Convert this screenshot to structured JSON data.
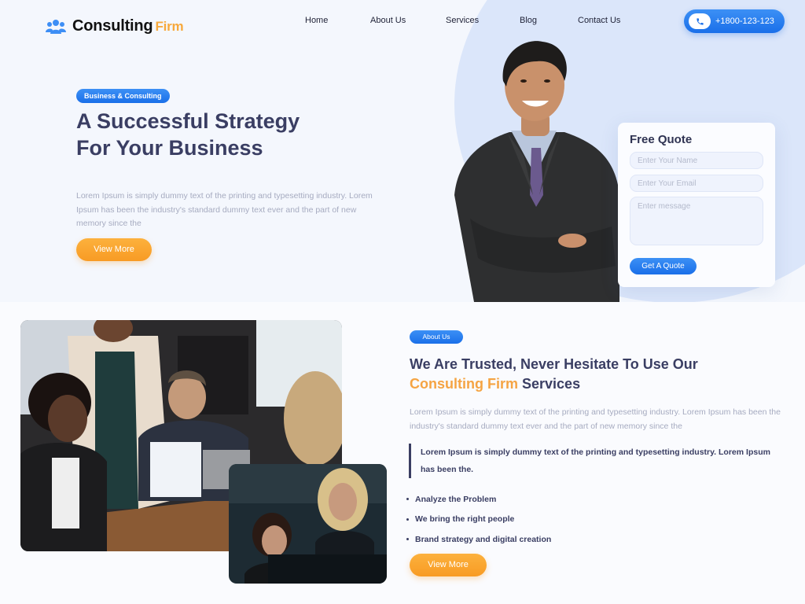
{
  "header": {
    "logo_main": "Consulting",
    "logo_accent": "Firm",
    "nav": [
      {
        "label": "Home"
      },
      {
        "label": "About Us"
      },
      {
        "label": "Services"
      },
      {
        "label": "Blog"
      },
      {
        "label": "Contact Us"
      }
    ],
    "phone": "+1800-123-123"
  },
  "hero": {
    "badge": "Business & Consulting",
    "title": "A Successful Strategy For Your Business",
    "description": "Lorem Ipsum is simply dummy text of the printing and typesetting industry. Lorem Ipsum has been the industry's standard dummy text ever and the part of new memory since the",
    "cta": "View More"
  },
  "quote_form": {
    "title": "Free Quote",
    "name_placeholder": "Enter Your Name",
    "email_placeholder": "Enter Your Email",
    "message_placeholder": "Enter message",
    "submit": "Get A Quote"
  },
  "about": {
    "badge": "About Us",
    "title_start": "We Are Trusted, Never Hesitate To Use Our",
    "title_accent": "Consulting Firm",
    "title_end": "Services",
    "description": "Lorem Ipsum is simply dummy text of the printing and typesetting industry. Lorem Ipsum has been the industry's standard dummy text ever and the part of new memory since the",
    "quote": "Lorem Ipsum is simply dummy text of the printing and typesetting industry. Lorem Ipsum has been the.",
    "bullets": [
      "Analyze the Problem",
      "We bring the right people",
      "Brand strategy and digital creation"
    ],
    "cta": "View More"
  },
  "colors": {
    "primary_blue": "#1a6fe9",
    "accent_orange": "#f89b24",
    "heading": "#3a3e63",
    "muted_text": "#a6abc0"
  }
}
